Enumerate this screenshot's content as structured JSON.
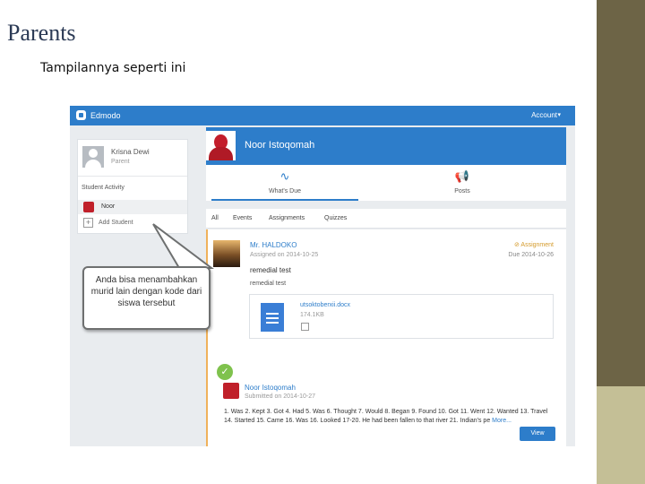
{
  "slide": {
    "title": "Parents",
    "subtitle": "Tampilannya  seperti ini"
  },
  "app": {
    "brand": "Edmodo",
    "account_label": "Account",
    "account_caret": "▾"
  },
  "left_panel": {
    "parent_name": "Krisna Dewi",
    "parent_role": "Parent",
    "activity_heading": "Student Activity",
    "student_name": "Noor",
    "add_icon": "+",
    "add_student_label": "Add Student"
  },
  "header": {
    "student_name": "Noor Istoqomah",
    "tabs": [
      {
        "label": "What's Due",
        "icon": "activity-pulse-icon",
        "glyph": "∿"
      },
      {
        "label": "Posts",
        "icon": "megaphone-icon",
        "glyph": "📢"
      }
    ]
  },
  "filters": [
    "All",
    "Events",
    "Assignments",
    "Quizzes"
  ],
  "assignment": {
    "teacher": "Mr. HALDOKO",
    "assigned_on": "Assigned on 2014-10-25",
    "type_label": "⊘ Assignment",
    "due": "Due 2014-10-26",
    "title": "remedial test",
    "body": "remedial test",
    "attachment": {
      "name": "utsoktoberxii.docx",
      "size": "174.1KB"
    }
  },
  "submission": {
    "check_glyph": "✓",
    "student": "Noor Istoqomah",
    "submitted_on": "Submitted on 2014-10-27",
    "answers": "1. Was 2. Kept 3. Got 4. Had 5. Was 6. Thought 7. Would 8. Began 9. Found 10. Got 11. Went 12. Wanted 13. Travel 14. Started 15. Came 16. Was 16. Looked 17-20. He had been fallen to that river 21. Indian's pe",
    "more_label": "More...",
    "view_button": "View"
  },
  "callout": {
    "text": "Anda bisa menambahkan murid lain dengan kode dari siswa tersebut"
  },
  "colors": {
    "edmodo_blue": "#2d7dca",
    "side_bar": "#6d6446",
    "side_bar_accent": "#c4bf96",
    "assignment_orange": "#d49a2a",
    "check_green": "#7fc24d"
  }
}
